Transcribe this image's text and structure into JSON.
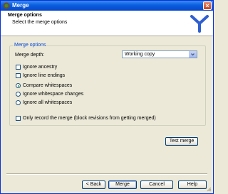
{
  "window": {
    "title": "Merge",
    "accent_color": "#0a5ee0"
  },
  "header": {
    "title": "Merge options",
    "subtitle": "Select the merge options"
  },
  "group": {
    "legend": "Merge options"
  },
  "depth": {
    "label": "Merge depth:",
    "value": "Working copy"
  },
  "options": {
    "ignore_ancestry": {
      "label": "Ignore ancestry",
      "checked": false
    },
    "ignore_line_endings": {
      "label": "Ignore line endings",
      "checked": false
    },
    "compare_whitespaces": {
      "label": "Compare whitespaces",
      "selected": true
    },
    "ignore_whitespace_changes": {
      "label": "Ignore whitespace changes",
      "selected": false
    },
    "ignore_all_whitespaces": {
      "label": "Ignore all whitespaces",
      "selected": false
    }
  },
  "record_only": {
    "label": "Only record the merge (block revisions from getting merged)",
    "checked": false
  },
  "buttons": {
    "test_merge": "Test merge",
    "back": "< Back",
    "merge": "Merge",
    "cancel": "Cancel",
    "help": "Help"
  },
  "icons": {
    "app": "tortoisesvn-app-icon",
    "logo": "merge-logo-icon",
    "close": "close-icon"
  }
}
